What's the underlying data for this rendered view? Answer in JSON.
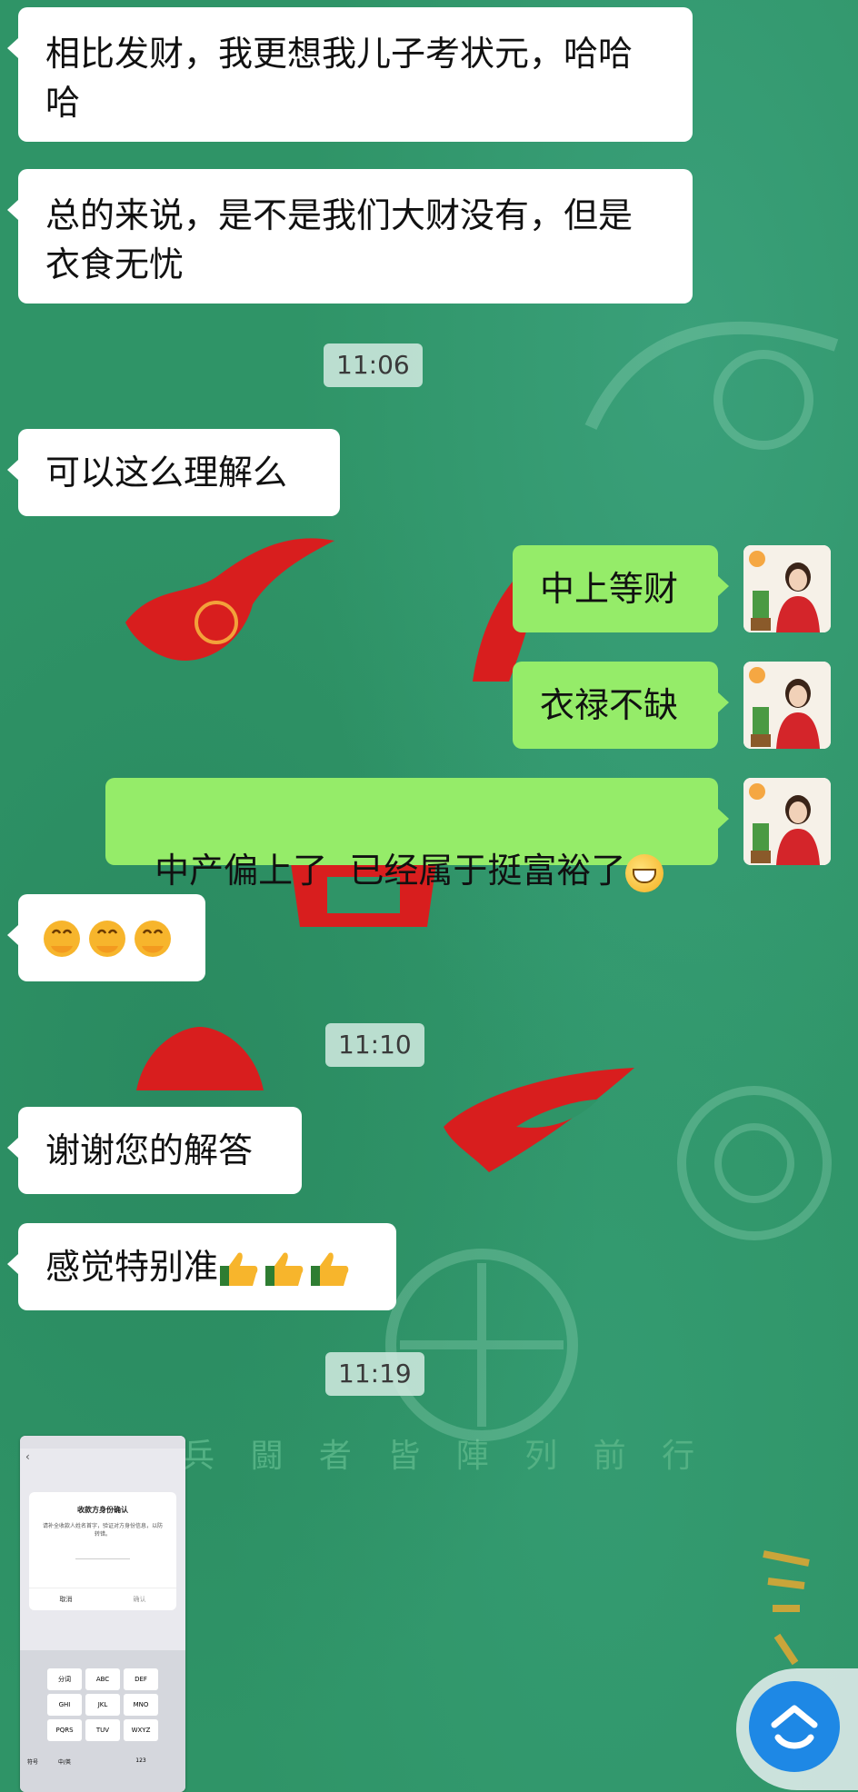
{
  "messages": [
    {
      "side": "left",
      "text": "相比发财，我更想我儿子考状元，哈哈哈"
    },
    {
      "side": "left",
      "text": "总的来说，是不是我们大财没有，但是衣食无忧"
    },
    {
      "side": "time",
      "text": "11:06"
    },
    {
      "side": "left",
      "text": "可以这么理解么"
    },
    {
      "side": "right",
      "text": "中上等财"
    },
    {
      "side": "right",
      "text": "衣禄不缺"
    },
    {
      "side": "right",
      "text": "中产偏上了  已经属于挺富裕了"
    },
    {
      "side": "left",
      "text": ""
    },
    {
      "side": "time",
      "text": "11:10"
    },
    {
      "side": "left",
      "text": "谢谢您的解答"
    },
    {
      "side": "left",
      "text": "感觉特别准"
    },
    {
      "side": "time",
      "text": "11:19"
    }
  ],
  "emojis": {
    "grin": "grinning-face-emoji",
    "hug": "hugging-face-emoji",
    "thumbs": "thumbs-up-emoji"
  },
  "thumbnail": {
    "dialog_title": "收款方身份确认",
    "dialog_text": "请补全收款人姓名首字，验证对方身份信息，以防转错。",
    "cancel": "取消",
    "confirm": "确认",
    "keys": [
      "分词",
      "ABC",
      "DEF",
      "GHI",
      "JKL",
      "MNO",
      "PQRS",
      "TUV",
      "WXYZ"
    ],
    "key_symbol": "符号",
    "key_lang": "中/英",
    "key_num": "123"
  },
  "background": {
    "banner_text": "兵 闘 者 皆 陣 列 前 行"
  },
  "colors": {
    "bg": "#2f9467",
    "bubble_left": "#ffffff",
    "bubble_right": "#95ec69",
    "red": "#d81e1e",
    "fab": "#1e88e5"
  }
}
